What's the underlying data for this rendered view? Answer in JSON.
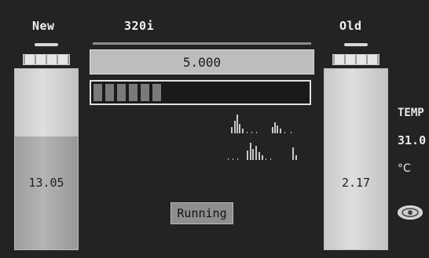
{
  "labels": {
    "left": "New",
    "center": "320i",
    "right": "Old"
  },
  "left_canister": {
    "value": "13.05",
    "level": 0.62
  },
  "right_canister": {
    "value": "2.17",
    "level": 0.0
  },
  "display": {
    "number": "5.000"
  },
  "progress": {
    "segments_total": 22,
    "segments_lit": 6
  },
  "status": {
    "label": "Running"
  },
  "temperature": {
    "title": "TEMP",
    "value": "31.0",
    "unit": "°C"
  },
  "icons": {
    "eye": "eye-icon"
  }
}
